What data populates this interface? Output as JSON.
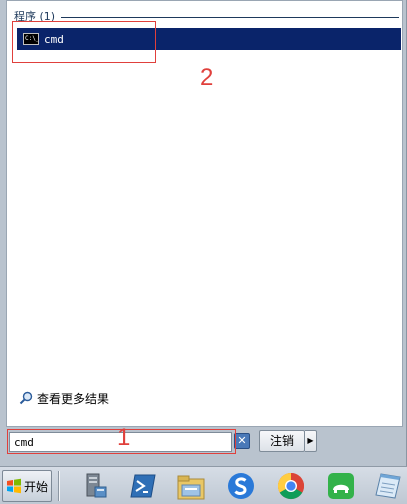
{
  "results": {
    "group_header": "程序 (1)",
    "items": [
      {
        "name": "cmd",
        "icon_text": "C:\\_",
        "icon": "command-prompt-icon"
      }
    ],
    "more_results": "查看更多结果"
  },
  "search": {
    "value": "cmd"
  },
  "buttons": {
    "logout_label": "注销",
    "arrow": "▶",
    "clear": "✕"
  },
  "taskbar": {
    "start_label": "开始",
    "items": [
      "server-manager-icon",
      "powershell-icon",
      "file-explorer-icon",
      "sogou-browser-icon",
      "chrome-icon",
      "green-app-icon",
      "notepad-icon"
    ]
  },
  "annotations": {
    "one": "1",
    "two": "2"
  },
  "colors": {
    "selection": "#0a246a",
    "annotation": "#e0403c",
    "header_text": "#1e395b"
  }
}
